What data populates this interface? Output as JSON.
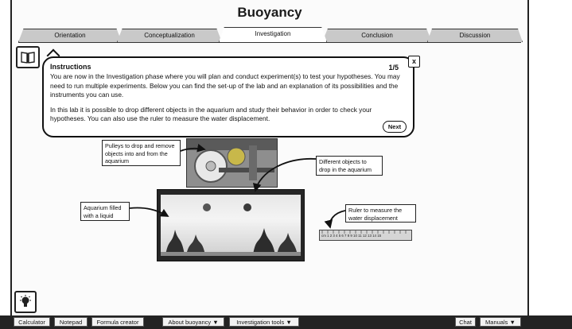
{
  "app": {
    "title": "Buoyancy"
  },
  "tabs": [
    {
      "label": "Orientation"
    },
    {
      "label": "Conceptualization"
    },
    {
      "label": "Investigation"
    },
    {
      "label": "Conclusion"
    },
    {
      "label": "Discussion"
    }
  ],
  "instructions": {
    "title": "Instructions",
    "page": "1/5",
    "close_label": "x",
    "paragraph1": "You are now in the Investigation phase where you will plan and conduct experiment(s) to test your hypotheses. You may need to run multiple experiments. Below you can find the set-up of the lab and an explanation of its possibilities and the instruments you can use.",
    "paragraph2": "In this lab it is possible to drop different objects in the aquarium and study their behavior in order to check your hypotheses. You can also use the ruler to measure the water displacement.",
    "next_label": "Next"
  },
  "lab": {
    "pulleys_label": "Pulleys to drop and remove objects into and from the aquarium",
    "objects_label": "Different objects to drop in the aquarium",
    "aquarium_label": "Aquarium filled with a liquid",
    "ruler_label": "Ruler to measure the water displacement",
    "ruler_numbers": "cm 1 2 3 4 5 6 7 8 9 10 11 12 13 14 15"
  },
  "toolbar": {
    "calculator": "Calculator",
    "notepad": "Notepad",
    "formula_creator": "Formula creator",
    "about": "About buoyancy",
    "investigation_tools": "Investigation tools",
    "chat": "Chat",
    "manuals": "Manuals"
  },
  "icons": {
    "book": "book-icon",
    "bulb": "lightbulb-icon",
    "dropdown": "triangle-down-icon"
  }
}
